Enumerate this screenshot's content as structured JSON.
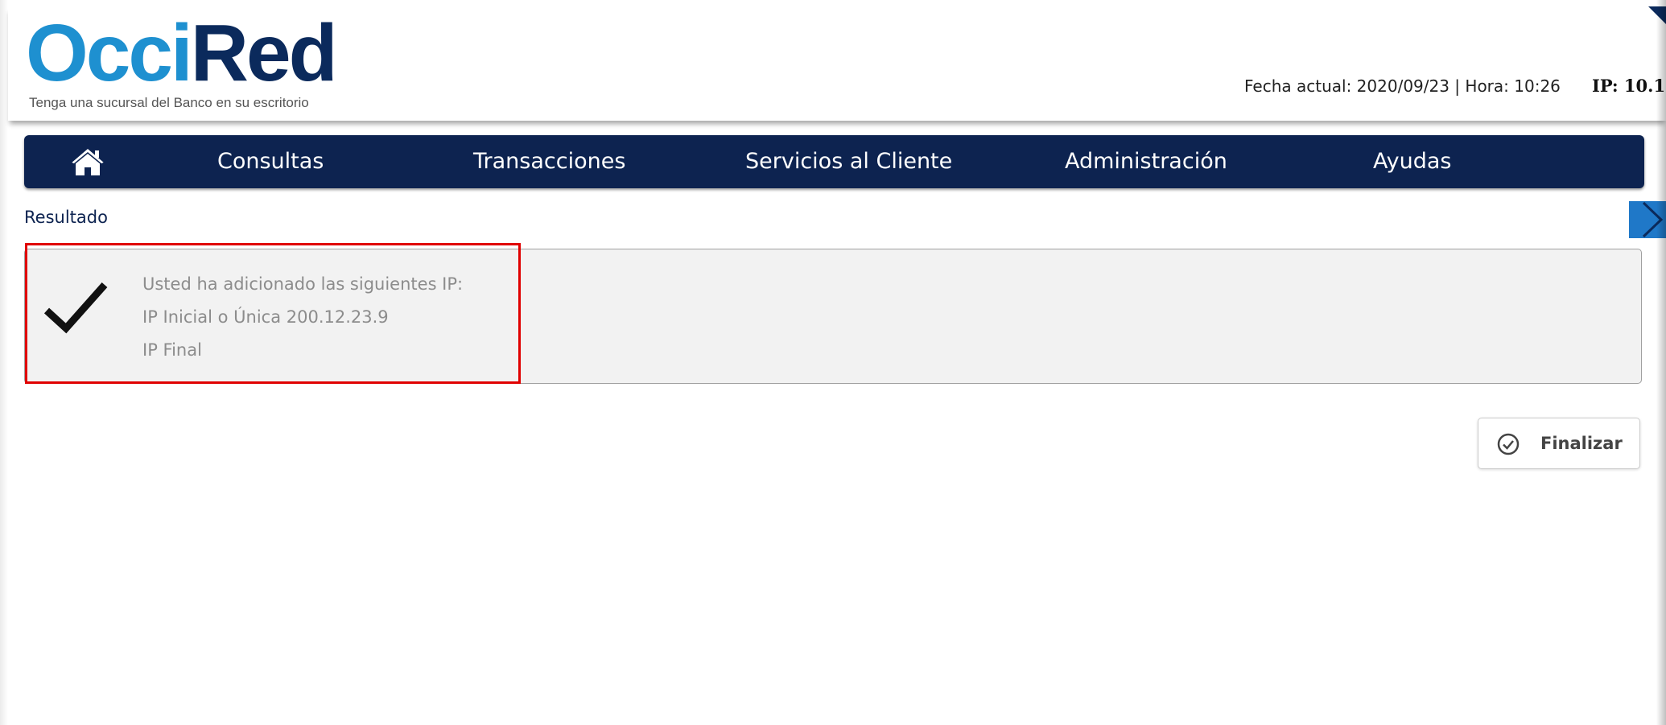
{
  "header": {
    "logo": {
      "part1": "Occi",
      "part2": "Red",
      "tagline": "Tenga una sucursal del Banco en su escritorio"
    },
    "info": "Fecha actual: 2020/09/23 | Hora: 10:26",
    "ip": "IP: 10.1"
  },
  "nav": {
    "home_icon": "home-icon",
    "items": [
      {
        "label": "Consultas"
      },
      {
        "label": "Transacciones"
      },
      {
        "label": "Servicios al Cliente"
      },
      {
        "label": "Administración"
      },
      {
        "label": "Ayudas"
      }
    ]
  },
  "result": {
    "label": "Resultado",
    "icon": "checkmark-icon",
    "lines": [
      "Usted ha adicionado las siguientes IP:",
      "IP Inicial o Única 200.12.23.9",
      "IP Final"
    ]
  },
  "actions": {
    "finalizar": {
      "label": "Finalizar",
      "icon": "check-circle-icon"
    }
  },
  "colors": {
    "brand_light": "#1e90d0",
    "brand_dark": "#0b2a5c",
    "nav_bg": "#0d2350",
    "highlight": "#e00000",
    "side_arrow": "#1f78c8"
  }
}
